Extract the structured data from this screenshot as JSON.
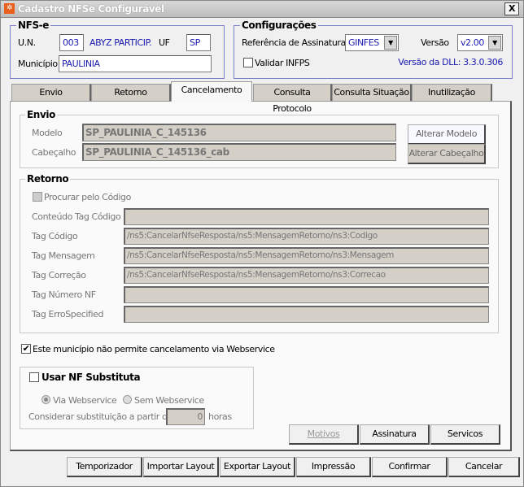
{
  "window": {
    "title": "Cadastro NFSe Configurável",
    "close": "X"
  },
  "nfse": {
    "legend": "NFS-e",
    "un_label": "U.N.",
    "un_value": "003",
    "company": "ABYZ PARTICIP.",
    "uf_label": "UF",
    "uf_value": "SP",
    "municipio_label": "Município",
    "municipio_value": "PAULINIA"
  },
  "config": {
    "legend": "Configurações",
    "ref_label": "Referência de Assinatura",
    "ref_value": "GINFES",
    "versao_label": "Versão",
    "versao_value": "v2.00",
    "validar_label": "Validar INFPS",
    "validar_checked": false,
    "dll_version": "Versão da DLL: 3.3.0.306"
  },
  "tabs": [
    {
      "label": "Envio"
    },
    {
      "label": "Retorno"
    },
    {
      "label": "Cancelamento",
      "selected": true
    },
    {
      "label": "Consulta Protocolo"
    },
    {
      "label": "Consulta Situação"
    },
    {
      "label": "Inutilização"
    }
  ],
  "envio": {
    "legend": "Envio",
    "modelo_label": "Modelo",
    "modelo_value": "SP_PAULINIA_C_145136",
    "cabecalho_label": "Cabeçalho",
    "cabecalho_value": "SP_PAULINIA_C_145136_cab",
    "alterar_modelo": "Alterar Modelo",
    "alterar_cabecalho": "Alterar Cabeçalho"
  },
  "retorno": {
    "legend": "Retorno",
    "procurar_label": "Procurar pelo Código",
    "rows": [
      {
        "label": "Conteúdo Tag Código",
        "value": ""
      },
      {
        "label": "Tag Código",
        "value": "/ns5:CancelarNfseResposta/ns5:MensagemRetorno/ns3:Codigo"
      },
      {
        "label": "Tag Mensagem",
        "value": "/ns5:CancelarNfseResposta/ns5:MensagemRetorno/ns3:Mensagem"
      },
      {
        "label": "Tag Correção",
        "value": "/ns5:CancelarNfseResposta/ns5:MensagemRetorno/ns3:Correcao"
      },
      {
        "label": "Tag Número NF",
        "value": ""
      },
      {
        "label": "Tag ErroSpecified",
        "value": ""
      }
    ]
  },
  "nao_permite": {
    "label": "Este município não permite cancelamento via Webservice",
    "checked": true
  },
  "substituta": {
    "label": "Usar NF Substituta",
    "checked": false,
    "radio_via": "Via Webservice",
    "radio_sem": "Sem Webservice",
    "selected": "Via Webservice",
    "considerar_label": "Considerar substituição a partir de",
    "horas_value": "0",
    "horas_label": "horas"
  },
  "panel_buttons": {
    "motivos": "Motivos",
    "assinatura": "Assinatura",
    "servicos": "Servicos"
  },
  "footer": {
    "temporizador": "Temporizador",
    "importar": "Importar Layout",
    "exportar": "Exportar Layout",
    "impressao": "Impressão",
    "confirmar": "Confirmar",
    "cancelar": "Cancelar"
  }
}
